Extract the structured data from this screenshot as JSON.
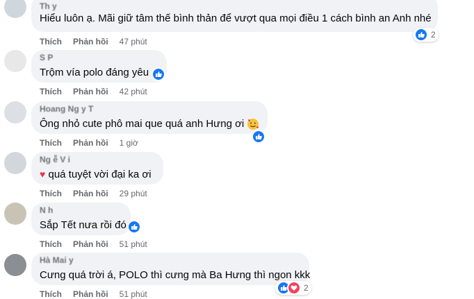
{
  "comments": [
    {
      "name": "Th y",
      "text": "Hiểu luôn ạ. Mãi giữ tâm thế bình thản để vượt qua mọi điều 1 cách bình an Anh nhé",
      "like": "Thích",
      "reply": "Phản hồi",
      "time": "47 phút",
      "reaction_count": "2"
    },
    {
      "name": "S   P",
      "text": "Trộm vía polo đáng yêu",
      "like": "Thích",
      "reply": "Phản hồi",
      "time": "42 phút"
    },
    {
      "name": "Hoang Ng y   T",
      "text": "Ông nhỏ cute phô mai que quá anh Hưng ơi",
      "like": "Thích",
      "reply": "Phản hồi",
      "time": "1 giờ"
    },
    {
      "name": "Ng  ễ  V i",
      "text": "quá tuyệt vời đại ka ơi",
      "like": "Thích",
      "reply": "Phản hồi",
      "time": "29 phút"
    },
    {
      "name": "N   h",
      "text": "Sắp Tết nưa rồi đó",
      "like": "Thích",
      "reply": "Phản hồi",
      "time": "51 phút"
    },
    {
      "name": "Hà Mai   y",
      "text": "Cưng quá trời á, POLO thì cưng mà Ba Hưng thì ngon kkk",
      "like": "Thích",
      "reply": "Phản hồi",
      "time": "51 phút",
      "reaction_count": "2"
    }
  ],
  "colors": {
    "bubble": "#f0f2f5",
    "like_blue": "#1877f2",
    "love_red": "#f3425f",
    "meta_gray": "#65676b"
  }
}
